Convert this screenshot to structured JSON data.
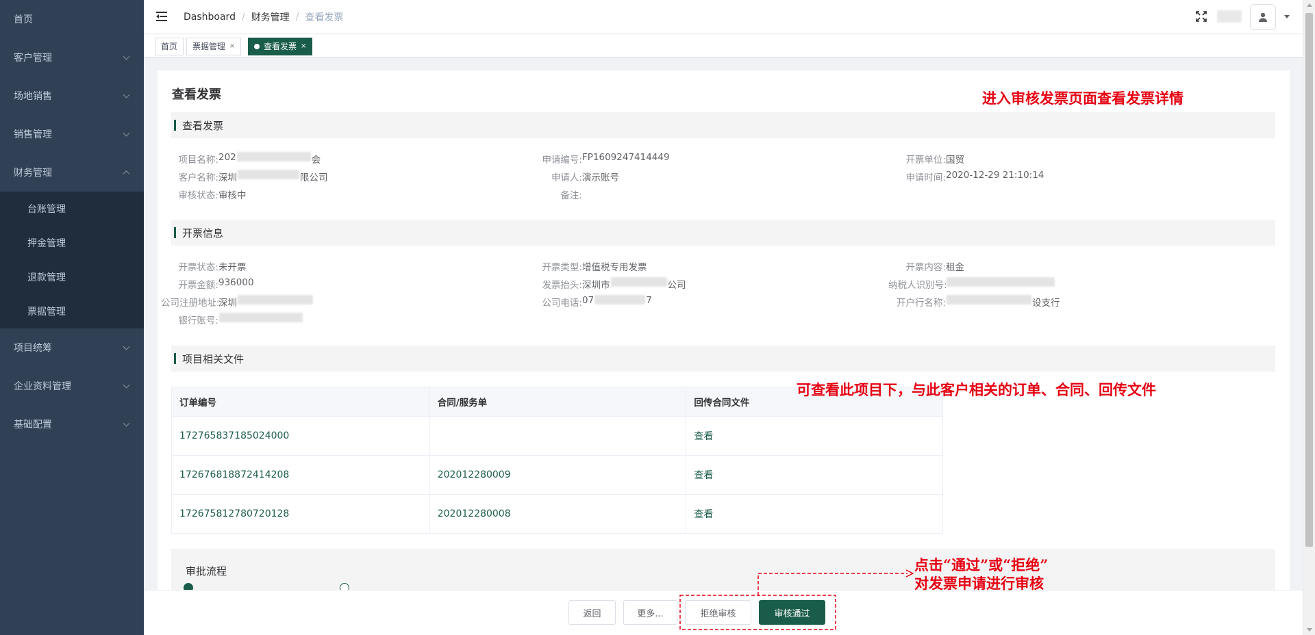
{
  "sidebar": {
    "items": [
      {
        "label": "首页"
      },
      {
        "label": "客户管理"
      },
      {
        "label": "场地销售"
      },
      {
        "label": "销售管理"
      },
      {
        "label": "财务管理"
      },
      {
        "label": "项目统筹"
      },
      {
        "label": "企业资料管理"
      },
      {
        "label": "基础配置"
      }
    ],
    "finance_sub": [
      {
        "label": "台账管理"
      },
      {
        "label": "押金管理"
      },
      {
        "label": "退款管理"
      },
      {
        "label": "票据管理"
      }
    ]
  },
  "breadcrumb": {
    "dashboard": "Dashboard",
    "sep": "/",
    "level2": "财务管理",
    "level3": "查看发票"
  },
  "tags": {
    "home": "首页",
    "tickets": "票据管理",
    "current": "查看发票",
    "close": "×"
  },
  "page": {
    "title": "查看发票"
  },
  "sections": {
    "invoice": "查看发票",
    "billing": "开票信息",
    "files": "项目相关文件"
  },
  "invoice": {
    "project_name_k": "项目名称:",
    "project_name_pre": "202",
    "project_name_post": "会",
    "customer_k": "客户名称:",
    "customer_pre": "深圳",
    "customer_post": "限公司",
    "status_k": "审核状态:",
    "status_v": "审核中",
    "apply_no_k": "申请编号:",
    "apply_no_v": "FP1609247414449",
    "applicant_k": "申请人:",
    "applicant_v": "演示账号",
    "remark_k": "备注:",
    "unit_k": "开票单位:",
    "unit_v": "国贸",
    "apply_time_k": "申请时间:",
    "apply_time_v": "2020-12-29 21:10:14"
  },
  "billing": {
    "state_k": "开票状态:",
    "state_v": "未开票",
    "amount_k": "开票金额:",
    "amount_v": "936000",
    "address_k": "公司注册地址:",
    "address_pre": "深圳",
    "address_post": "",
    "bank_acct_k": "银行账号:",
    "type_k": "开票类型:",
    "type_v": "增值税专用发票",
    "header_k": "发票抬头:",
    "header_pre": "深圳市",
    "header_post": "公司",
    "phone_k": "公司电话:",
    "phone_pre": "07",
    "phone_post": "7",
    "content_k": "开票内容:",
    "content_v": "租金",
    "taxid_k": "纳税人识别号:",
    "bank_name_k": "开户行名称:",
    "bank_name_post": "设支行"
  },
  "files_table": {
    "headers": [
      "订单编号",
      "合同/服务单",
      "回传合同文件"
    ],
    "rows": [
      [
        "172765837185024000",
        "",
        "查看"
      ],
      [
        "172676818872414208",
        "202012280009",
        "查看"
      ],
      [
        "172675812780720128",
        "202012280008",
        "查看"
      ]
    ]
  },
  "approval": {
    "label": "审批流程"
  },
  "footer": {
    "back": "返回",
    "more": "更多...",
    "reject": "拒绝审核",
    "approve": "审核通过"
  },
  "annotations": {
    "top": "进入审核发票页面查看发票详情",
    "middle": "可查看此项目下，与此客户相关的订单、合同、回传文件",
    "bottom_line1": "点击“通过”或“拒绝”",
    "bottom_line2": "对发票申请进行审核"
  },
  "colors": {
    "accent": "#1a5c4a",
    "sidebar": "#304156",
    "annotation": "#e60012"
  }
}
